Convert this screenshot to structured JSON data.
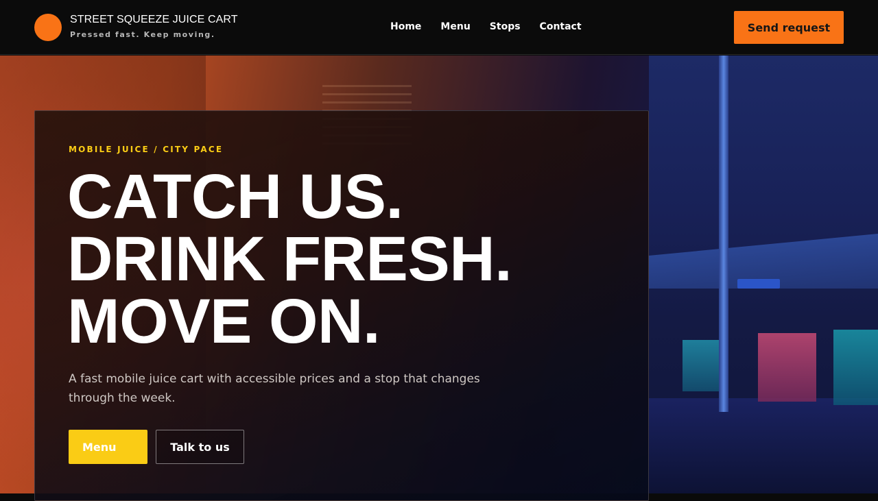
{
  "header": {
    "brand_name": "STREET SQUEEZE JUICE CART",
    "brand_tagline": "Pressed fast. Keep moving.",
    "nav": [
      {
        "label": "Home"
      },
      {
        "label": "Menu"
      },
      {
        "label": "Stops"
      },
      {
        "label": "Contact"
      }
    ],
    "cta_label": "Send request"
  },
  "hero": {
    "eyebrow": "MOBILE JUICE / CITY PACE",
    "headline_lines": [
      "CATCH US.",
      "DRINK FRESH.",
      "MOVE ON."
    ],
    "lede": "A fast mobile juice cart with accessible prices and a stop that changes through the week.",
    "primary_button": "Menu",
    "secondary_button": "Talk to us"
  },
  "colors": {
    "accent_orange": "#f97316",
    "accent_yellow": "#facc15",
    "topbar_bg": "#0b0b0b"
  }
}
